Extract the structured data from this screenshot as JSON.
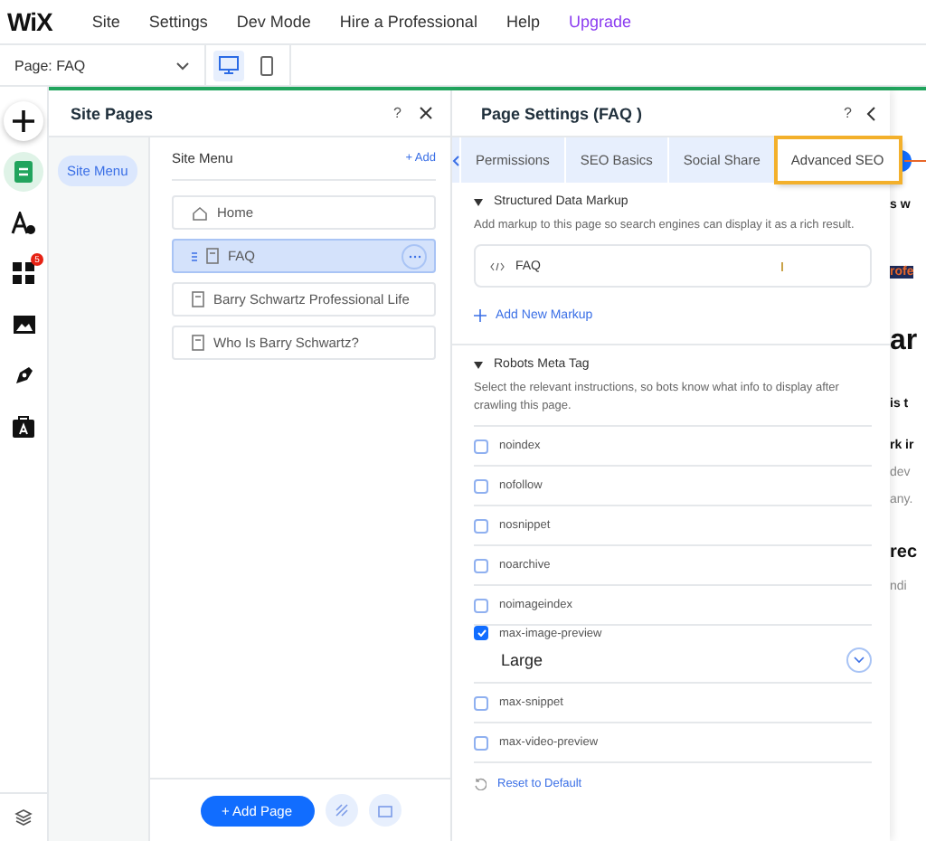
{
  "menu_bar": {
    "logo": "WiX",
    "items": [
      {
        "label": "Site",
        "kind": "plain"
      },
      {
        "label": "Settings",
        "kind": "plain"
      },
      {
        "label": "Dev Mode",
        "kind": "plain"
      },
      {
        "label": "Hire a Professional",
        "kind": "plain"
      },
      {
        "label": "Help",
        "kind": "plain"
      },
      {
        "label": "Upgrade",
        "kind": "upgrade"
      }
    ]
  },
  "page_bar": {
    "page_selector": "Page: FAQ",
    "devices": [
      {
        "kind": "desktop",
        "selected": true
      },
      {
        "kind": "mobile",
        "selected": false
      }
    ]
  },
  "left_rail": {
    "items": [
      {
        "kind": "add",
        "selected": false
      },
      {
        "kind": "pages",
        "selected": true
      },
      {
        "kind": "design",
        "selected": false
      },
      {
        "kind": "apps",
        "selected": false,
        "badge": "5"
      },
      {
        "kind": "media",
        "selected": false
      },
      {
        "kind": "pen",
        "selected": false
      },
      {
        "kind": "business",
        "selected": false
      }
    ]
  },
  "site_pages": {
    "title": "Site Pages",
    "help": "?",
    "sidebar": [
      {
        "label": "Site Menu",
        "selected": true
      }
    ],
    "menu_title": "Site Menu",
    "add_link": "+ Add",
    "pages": [
      {
        "label": "Home",
        "kind": "home",
        "selected": false
      },
      {
        "label": "FAQ",
        "kind": "page",
        "selected": true
      },
      {
        "label": "Barry Schwartz Professional Life",
        "kind": "page",
        "selected": false
      },
      {
        "label": "Who Is Barry Schwartz?",
        "kind": "page",
        "selected": false
      }
    ],
    "add_page": "+ Add Page"
  },
  "page_settings": {
    "title": "Page Settings (FAQ )",
    "help": "?",
    "tabs": [
      {
        "label": "Permissions",
        "selected": false,
        "highlighted": false
      },
      {
        "label": "SEO Basics",
        "selected": false,
        "highlighted": false
      },
      {
        "label": "Social Share",
        "selected": false,
        "highlighted": false
      },
      {
        "label": "Advanced SEO",
        "selected": true,
        "highlighted": true
      }
    ],
    "structured_data": {
      "title": "Structured Data Markup",
      "expanded": true,
      "description": "Add markup to this page so search engines can display it as a rich result.",
      "markups": [
        {
          "label": "FAQ"
        }
      ],
      "add": "Add New Markup"
    },
    "robots": {
      "title": "Robots Meta Tag",
      "expanded": true,
      "description": "Select the relevant instructions, so bots know what info to display after crawling this page.",
      "options": [
        {
          "label": "noindex",
          "checked": false
        },
        {
          "label": "nofollow",
          "checked": false
        },
        {
          "label": "nosnippet",
          "checked": false
        },
        {
          "label": "noarchive",
          "checked": false
        },
        {
          "label": "noimageindex",
          "checked": false
        },
        {
          "label": "max-image-preview",
          "checked": true,
          "value": "Large"
        },
        {
          "label": "max-snippet",
          "checked": false
        },
        {
          "label": "max-video-preview",
          "checked": false
        }
      ],
      "reset": "Reset to Default"
    }
  },
  "preview": {
    "fragments": [
      {
        "text": "s w",
        "kind": "bold"
      },
      {
        "text": "rofe",
        "kind": "banner"
      },
      {
        "text": "ar",
        "kind": "heading"
      },
      {
        "text": "is t",
        "kind": "bold"
      },
      {
        "text": "rk ir",
        "kind": "bold"
      },
      {
        "text": "dev",
        "kind": "body"
      },
      {
        "text": "any.",
        "kind": "body"
      },
      {
        "text": "rec",
        "kind": "subheading"
      },
      {
        "text": "ndi",
        "kind": "body"
      }
    ]
  }
}
